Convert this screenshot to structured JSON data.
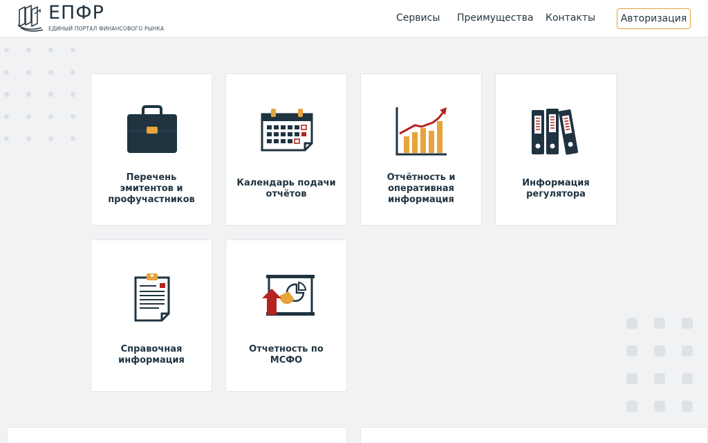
{
  "header": {
    "logo_title": "ЕПФР",
    "logo_subtitle": "ЕДИНЫЙ ПОРТАЛ ФИНАНСОВОГО РЫНКА",
    "nav": [
      "Сервисы",
      "Преимущества",
      "Контакты"
    ],
    "auth_label": "Авторизация"
  },
  "colors": {
    "navy": "#1f3340",
    "accent_orange": "#e8a33b",
    "accent_red": "#b5231e",
    "background": "#f1f2f4"
  },
  "cards": [
    {
      "label": "Перечень эмитентов и профучастников",
      "icon": "briefcase-icon"
    },
    {
      "label": "Календарь подачи отчётов",
      "icon": "calendar-icon"
    },
    {
      "label": "Отчётность и оперативная информация",
      "icon": "growth-chart-icon"
    },
    {
      "label": "Информация регулятора",
      "icon": "binders-icon"
    },
    {
      "label": "Справочная информация",
      "icon": "clipboard-document-icon"
    },
    {
      "label": "Отчетность по МСФО",
      "icon": "presentation-board-icon"
    }
  ]
}
